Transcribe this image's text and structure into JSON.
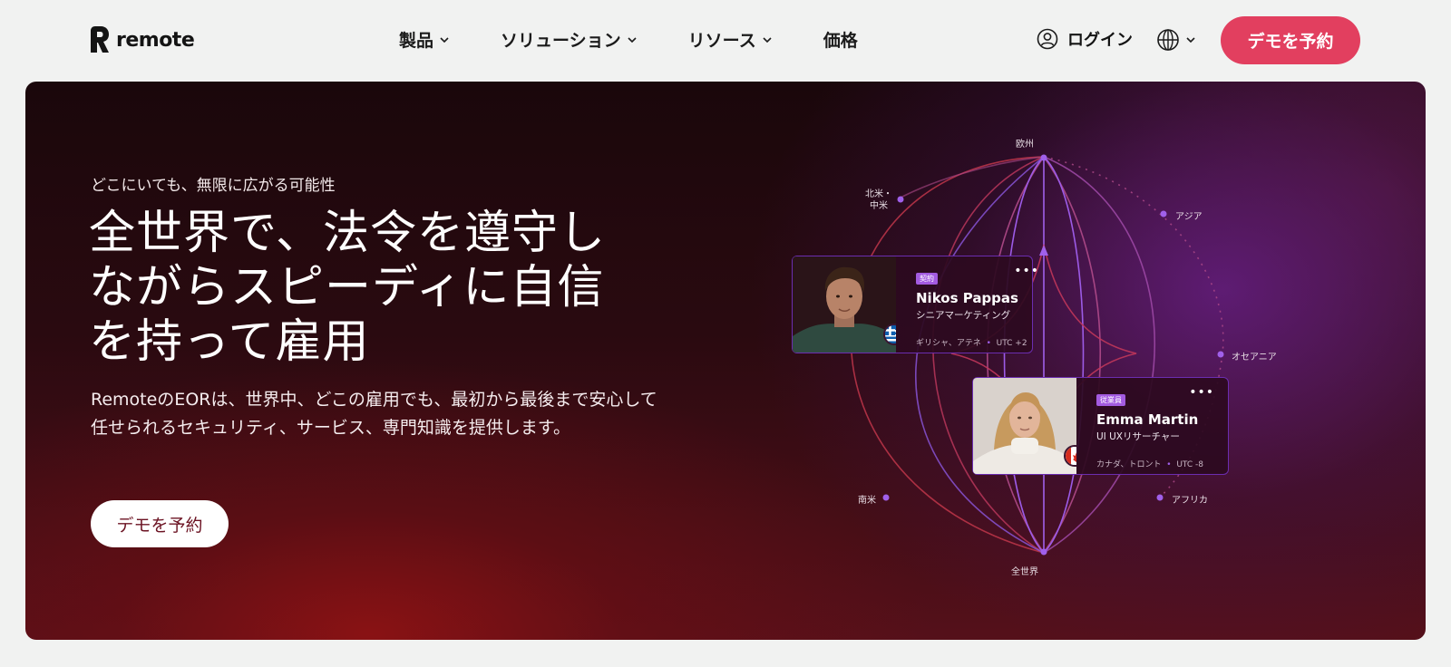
{
  "nav": {
    "logo_text": "remote",
    "menu": [
      {
        "label": "製品",
        "has_dropdown": true
      },
      {
        "label": "ソリューション",
        "has_dropdown": true
      },
      {
        "label": "リソース",
        "has_dropdown": true
      },
      {
        "label": "価格",
        "has_dropdown": false
      }
    ],
    "login_label": "ログイン",
    "cta_label": "デモを予約",
    "icons": {
      "login": "user-circle-icon",
      "language": "globe-icon"
    }
  },
  "hero": {
    "eyebrow": "どこにいても、無限に広がる可能性",
    "headline": "全世界で、法令を遵守しながらスピーディに自信を持って雇用",
    "description": "RemoteのEORは、世界中、どこの雇用でも、最初から最後まで安心して任せられるセキュリティ、サービス、専門知識を提供します。",
    "cta_label": "デモを予約"
  },
  "regions": {
    "europe": "欧州",
    "north_central_america": "北米・\n中米",
    "asia": "アジア",
    "oceania": "オセアニア",
    "south_america": "南米",
    "africa": "アフリカ",
    "global": "全世界"
  },
  "cards": [
    {
      "tag": "契約",
      "name": "Nikos Pappas",
      "role": "シニアマーケティング",
      "location": "ギリシャ、アテネ",
      "timezone": "UTC +2",
      "flag": "greece-flag-icon"
    },
    {
      "tag": "従業員",
      "name": "Emma Martin",
      "role": "UI UXリサーチャー",
      "location": "カナダ、トロント",
      "timezone": "UTC -8",
      "flag": "canada-flag-icon"
    }
  ],
  "colors": {
    "brand_pink": "#e23f5f",
    "accent_purple": "#a35be0",
    "hero_dark": "#1a070b"
  }
}
